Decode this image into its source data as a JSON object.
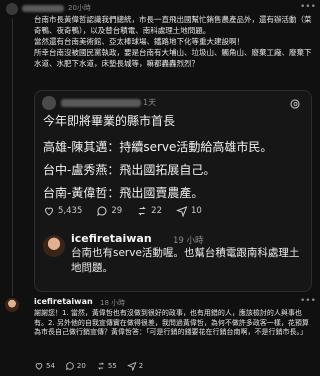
{
  "top_post": {
    "time": "20小時",
    "body": "台南市長黃偉哲認識我們總統，市長一直飛出國幫忙銷售農產品外，還有辦活動（菜奇鴨、夜奇鴨），以及替台積電、南科處理土地問題。\n當然還有台南美術館、亞太棒球場、鐵路地下化等重大建設啊！\n所幸台南沒被國民黨執政，要是台南有大埔山、垃圾山、觸角山、廢棄工廠、廢棄下水道、水肥下水道，床墊長城等，嘛都轟轟烈烈？"
  },
  "quote": {
    "time": "1天",
    "headline": "今年即將畢業的縣市首長",
    "lines": [
      "高雄-陳其邁：持續serve活動給高雄市民。",
      "台中-盧秀燕：飛出國拓展自己。",
      "台南-黃偉哲：飛出國賣農產。"
    ],
    "likes": "5,435",
    "comments": "29",
    "reposts": "22",
    "shares": "10"
  },
  "nested_reply": {
    "username": "icefiretaiwan",
    "time": "19 小時",
    "text": "台南也有serve活動喔。也幫台積電跟南科處理土地問題。"
  },
  "bottom_reply": {
    "username": "icefiretaiwan",
    "time": "18 小時",
    "body": "謝謝您！1. 當然，黃偉哲也有沒做到很好的政事，也有用錯的人，應該檢討的人與事也有。2. 另外他的自我宣傳實在做得很差，我問過黃偉哲，為何不做許多政客一樣，花預算為市長自己做行銷宣傳？黃偉哲答：「可是行銷的錢要花在行銷台南啊，不是行銷市長。」",
    "likes": "54",
    "comments": "20",
    "reposts": "55",
    "shares": "2"
  }
}
